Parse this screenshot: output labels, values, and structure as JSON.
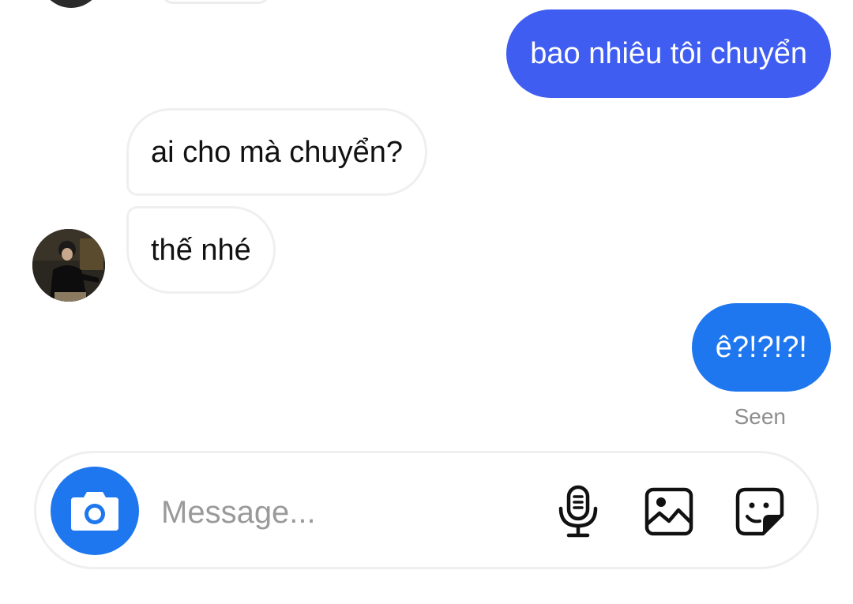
{
  "conversation": {
    "messages": [
      {
        "direction": "outgoing",
        "text": "bao nhiêu tôi chuyển",
        "color": "#3f5df0"
      },
      {
        "direction": "incoming",
        "text": "ai cho mà chuyển?"
      },
      {
        "direction": "incoming",
        "text": "thế nhé"
      },
      {
        "direction": "outgoing",
        "text": "ê?!?!?!",
        "color": "#1e77ee"
      }
    ],
    "seen_status": "Seen"
  },
  "composer": {
    "placeholder": "Message...",
    "value": "",
    "camera_icon": "camera-icon",
    "mic_icon": "microphone-icon",
    "gallery_icon": "image-icon",
    "sticker_icon": "sticker-icon",
    "accent_color": "#1e77ee"
  }
}
